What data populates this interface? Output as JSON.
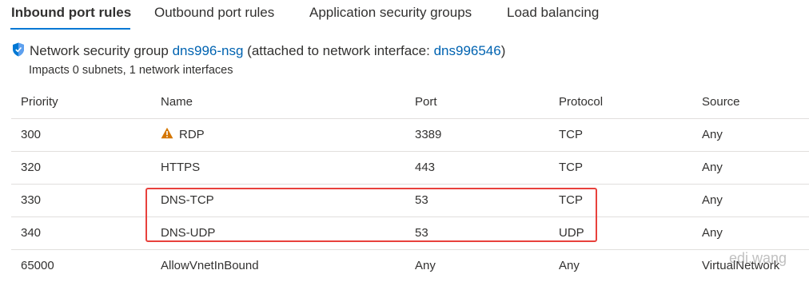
{
  "tabs": [
    {
      "label": "Inbound port rules",
      "active": true
    },
    {
      "label": "Outbound port rules",
      "active": false
    },
    {
      "label": "Application security groups",
      "active": false
    },
    {
      "label": "Load balancing",
      "active": false
    }
  ],
  "nsg": {
    "prefix": "Network security group",
    "name": "dns996-nsg",
    "middle": "(attached to network interface:",
    "interface": "dns996546",
    "suffix": ")",
    "impacts": "Impacts 0 subnets, 1 network interfaces"
  },
  "table": {
    "headers": {
      "priority": "Priority",
      "name": "Name",
      "port": "Port",
      "protocol": "Protocol",
      "source": "Source"
    },
    "rows": [
      {
        "priority": "300",
        "name": "RDP",
        "warning": true,
        "port": "3389",
        "protocol": "TCP",
        "source": "Any"
      },
      {
        "priority": "320",
        "name": "HTTPS",
        "warning": false,
        "port": "443",
        "protocol": "TCP",
        "source": "Any"
      },
      {
        "priority": "330",
        "name": "DNS-TCP",
        "warning": false,
        "port": "53",
        "protocol": "TCP",
        "source": "Any"
      },
      {
        "priority": "340",
        "name": "DNS-UDP",
        "warning": false,
        "port": "53",
        "protocol": "UDP",
        "source": "Any"
      },
      {
        "priority": "65000",
        "name": "AllowVnetInBound",
        "warning": false,
        "port": "Any",
        "protocol": "Any",
        "source": "VirtualNetwork"
      }
    ]
  },
  "watermark": "edi.wang",
  "colors": {
    "accent": "#0078d4",
    "link": "#0063b1",
    "warning": "#d47500",
    "highlight": "#e8413c"
  }
}
